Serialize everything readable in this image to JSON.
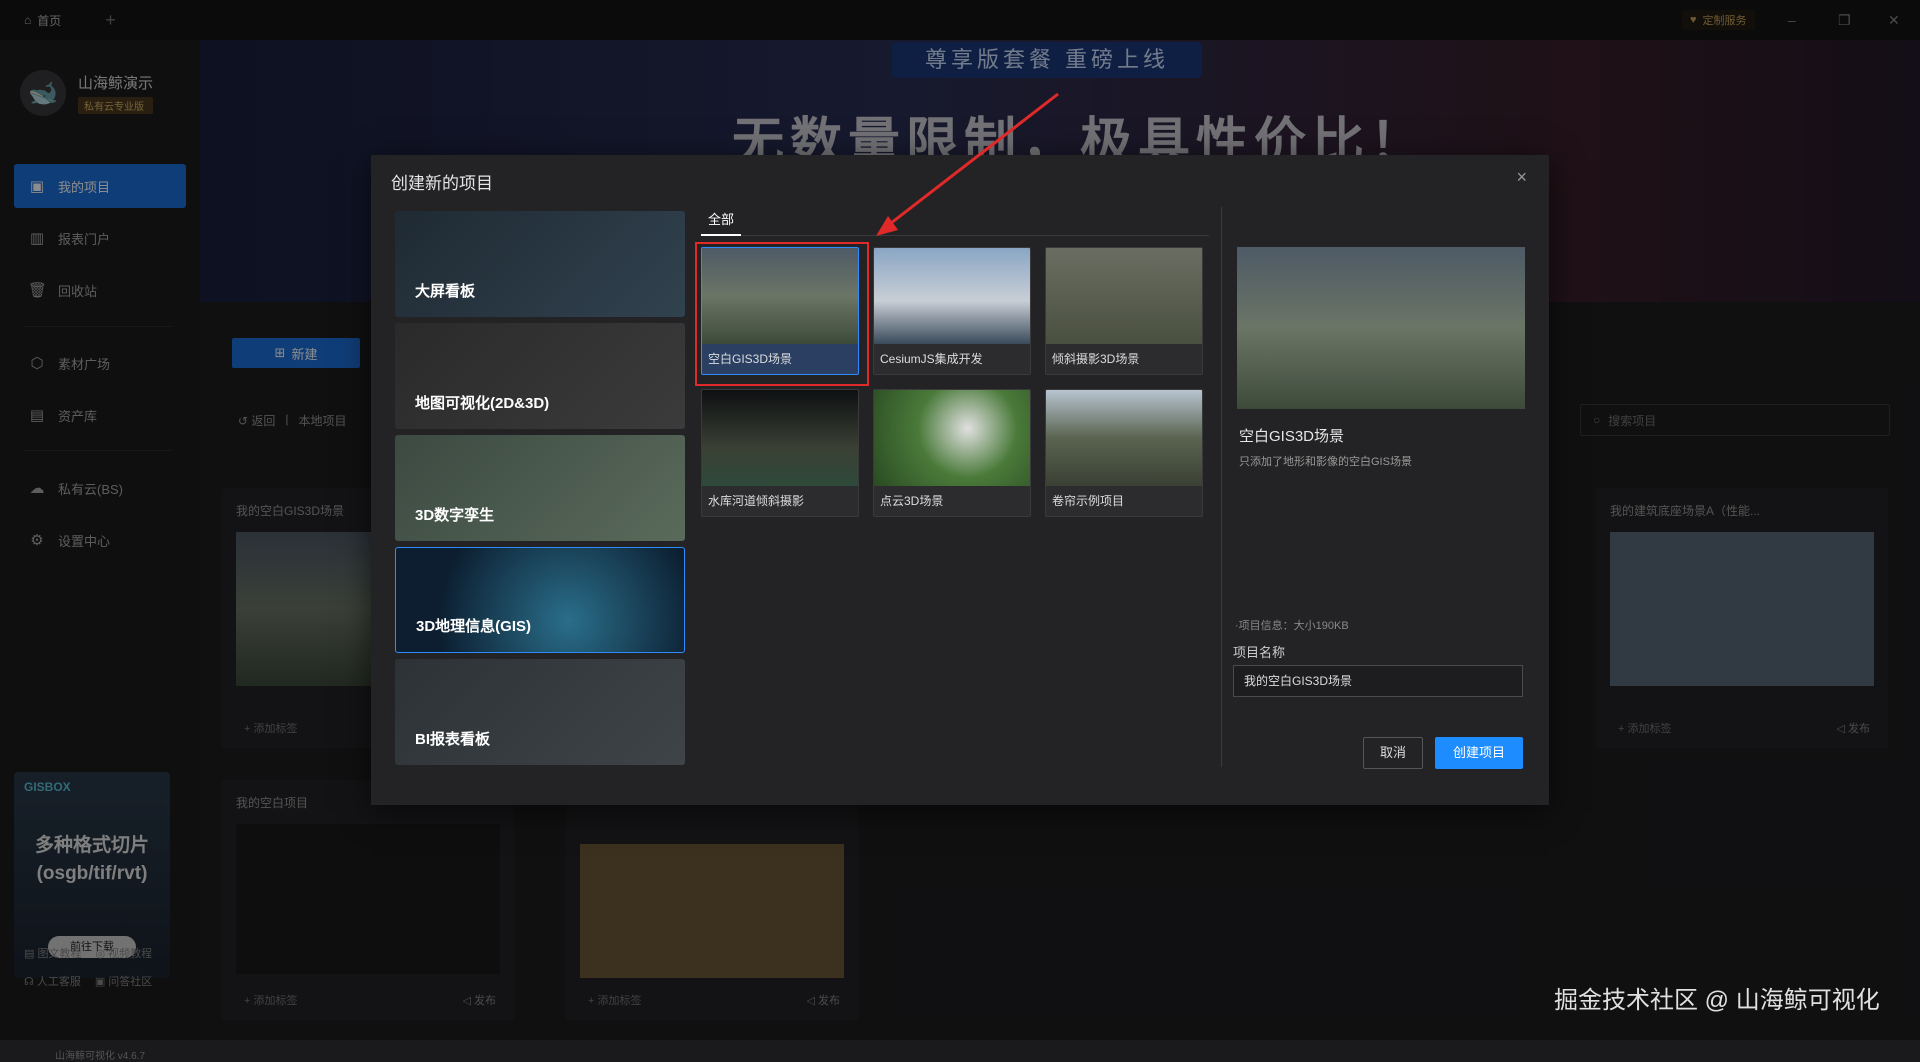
{
  "titlebar": {
    "home_tab": "首页",
    "custom_service": "定制服务"
  },
  "profile": {
    "name": "山海鲸演示",
    "badge": "私有云专业版"
  },
  "sidebar": {
    "items": [
      {
        "label": "我的项目"
      },
      {
        "label": "报表门户"
      },
      {
        "label": "回收站"
      },
      {
        "label": "素材广场"
      },
      {
        "label": "资产库"
      },
      {
        "label": "私有云(BS)"
      },
      {
        "label": "设置中心"
      }
    ],
    "promo": {
      "brand": "GISBOX",
      "text": "多种格式切片\n(osgb/tif/rvt)",
      "button": "前往下载"
    },
    "links": [
      "图文教程",
      "视频教程",
      "人工客服",
      "问答社区"
    ],
    "version": "山海鲸可视化 v4.6.7"
  },
  "banner": {
    "pill": "尊享版套餐 重磅上线",
    "headline": "无数量限制，极具性价比！"
  },
  "main": {
    "new_button": "新建",
    "back": "返回",
    "breadcrumb": "本地项目",
    "search_placeholder": "搜索项目",
    "cards": [
      {
        "title": "我的空白GIS3D场景",
        "tag": "添加标签"
      },
      {
        "title": "我的建筑底座场景A（性能...",
        "tag": "添加标签",
        "publish": "发布"
      },
      {
        "title": "我的空白项目",
        "tag": "添加标签",
        "publish": "发布"
      },
      {
        "title": "",
        "tag": "添加标签",
        "publish": "发布"
      }
    ]
  },
  "modal": {
    "title": "创建新的项目",
    "categories": [
      "大屏看板",
      "地图可视化(2D&3D)",
      "3D数字孪生",
      "3D地理信息(GIS)",
      "BI报表看板"
    ],
    "selected_category": "3D地理信息(GIS)",
    "tab": "全部",
    "templates": [
      "空白GIS3D场景",
      "CesiumJS集成开发",
      "倾斜摄影3D场景",
      "水库河道倾斜摄影",
      "点云3D场景",
      "卷帘示例项目"
    ],
    "selected_template": "空白GIS3D场景",
    "preview": {
      "title": "空白GIS3D场景",
      "desc": "只添加了地形和影像的空白GIS场景",
      "info": "·项目信息：大小190KB"
    },
    "name_label": "项目名称",
    "name_value": "我的空白GIS3D场景",
    "cancel": "取消",
    "create": "创建项目"
  },
  "watermark": "掘金技术社区 @ 山海鲸可视化",
  "colors": {
    "accent": "#1c6fd9",
    "create": "#1c8cff",
    "highlight": "#e02a2a"
  }
}
